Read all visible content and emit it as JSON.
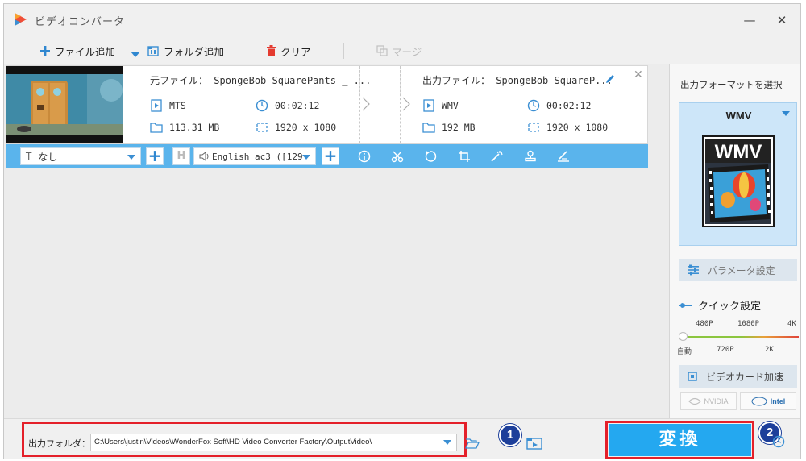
{
  "window": {
    "title": "ビデオコンバータ",
    "minimize_symbol": "—",
    "close_symbol": "✕"
  },
  "toolbar": {
    "add_file_label": "ファイル追加",
    "add_folder_label": "フォルダ追加",
    "clear_label": "クリア",
    "merge_label": "マージ"
  },
  "file": {
    "source_label": "元ファイル：",
    "source_name": "SpongeBob SquarePants _ ...",
    "source_format": "MTS",
    "source_duration": "00:02:12",
    "source_size": "113.31 MB",
    "source_resolution": "1920 x 1080",
    "output_label": "出力ファイル：",
    "output_name": "SpongeBob SquareP...",
    "output_format": "WMV",
    "output_duration": "00:02:12",
    "output_size": "192 MB",
    "output_resolution": "1920 x 1080",
    "remove_symbol": "✕"
  },
  "editbar": {
    "subtitle_value": "なし",
    "audio_value": "English ac3 ([129",
    "hard_sub_label": "H"
  },
  "right_panel": {
    "title": "出力フォーマットを選択",
    "format": "WMV",
    "format_logo_text": "WMV",
    "param_label": "パラメータ設定",
    "quick_label": "クイック設定",
    "quality_top": [
      "480P",
      "1080P",
      "4K"
    ],
    "quality_bottom": [
      "自動",
      "720P",
      "2K"
    ],
    "quality_selected": "自動",
    "gpu_label": "ビデオカード加速",
    "vendor_nvidia": "NVIDIA",
    "vendor_intel": "Intel"
  },
  "bottom": {
    "output_folder_label": "出力フォルダ：",
    "output_folder_path": "C:\\Users\\justin\\Videos\\WonderFox Soft\\HD Video Converter Factory\\OutputVideo\\",
    "badge1": "1",
    "badge2": "2",
    "convert_label": "変換"
  },
  "colors": {
    "accent": "#24a8f0",
    "editbar": "#5ab4ec",
    "highlight_frame": "#e4202a",
    "badge": "#1d3f9a",
    "format_box": "#cde6f9"
  }
}
